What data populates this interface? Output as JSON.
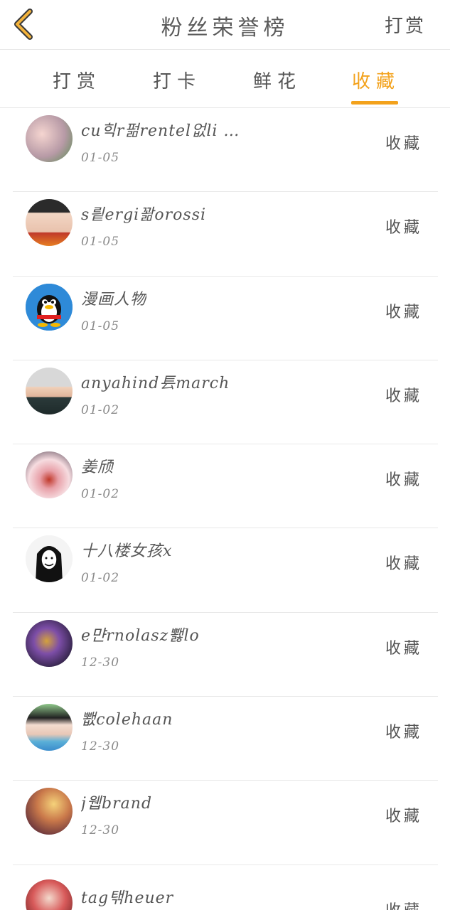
{
  "header": {
    "title": "粉丝荣誉榜",
    "right_action": "打赏"
  },
  "tabs": [
    {
      "label": "打赏",
      "active": false
    },
    {
      "label": "打卡",
      "active": false
    },
    {
      "label": "鲜花",
      "active": false
    },
    {
      "label": "收藏",
      "active": true
    }
  ],
  "colors": {
    "accent": "#f3a21c"
  },
  "rows": [
    {
      "name": "cu힉r펆rentel없li …",
      "date": "01-05",
      "action": "收藏"
    },
    {
      "name": "s릩ergi꽒orossi",
      "date": "01-05",
      "action": "收藏"
    },
    {
      "name": "漫画人物",
      "date": "01-05",
      "action": "收藏"
    },
    {
      "name": "anyahind镸march",
      "date": "01-02",
      "action": "收藏"
    },
    {
      "name": "姜颀",
      "date": "01-02",
      "action": "收藏"
    },
    {
      "name": "十八楼女孩x",
      "date": "01-02",
      "action": "收藏"
    },
    {
      "name": "e먄rnolasz뾇lo",
      "date": "12-30",
      "action": "收藏"
    },
    {
      "name": "뾊colehaan",
      "date": "12-30",
      "action": "收藏"
    },
    {
      "name": "j웹brand",
      "date": "12-30",
      "action": "收藏"
    },
    {
      "name": "tag탞heuer",
      "date": "",
      "action": "收藏"
    }
  ]
}
